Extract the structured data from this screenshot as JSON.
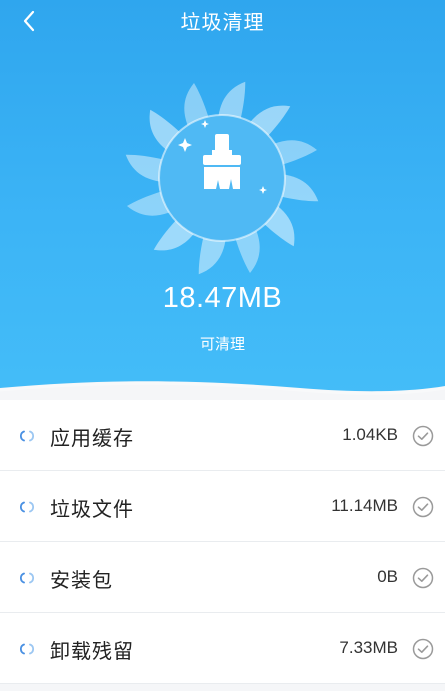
{
  "header": {
    "title": "垃圾清理",
    "back_icon": "chevron-left-icon"
  },
  "summary": {
    "size": "18.47MB",
    "caption": "可清理",
    "icon": "broom-icon"
  },
  "items": [
    {
      "label": "应用缓存",
      "value": "1.04KB"
    },
    {
      "label": "垃圾文件",
      "value": "11.14MB"
    },
    {
      "label": "安装包",
      "value": "0B"
    },
    {
      "label": "卸载残留",
      "value": "7.33MB"
    }
  ],
  "colors": {
    "header_blue": "#2fa6ee",
    "spinner_blue": "#4a90e2",
    "check_gray": "#9a9a9a"
  }
}
